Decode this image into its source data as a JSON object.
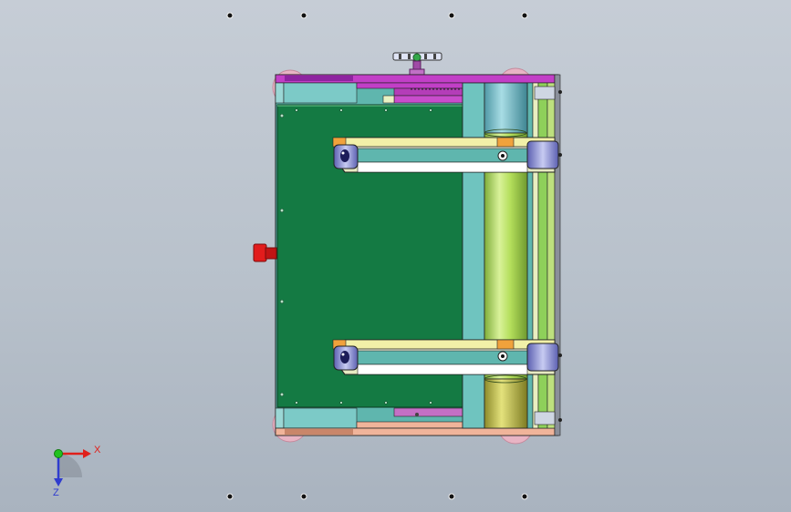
{
  "viewport": {
    "background_top": "#c6cdd6",
    "background_bottom": "#a9b3bf"
  },
  "triad": {
    "x_label": "X",
    "z_label": "Z",
    "x_color": "#e0201b",
    "z_color": "#2f3ccf",
    "y_color": "#21c21f"
  },
  "model": {
    "panel_color": "#147a43",
    "roller_color": "#b8e05a",
    "frame_color": "#6fc4bf",
    "top_bar_color": "#c23fc7",
    "bottom_bar_color": "#f0b49a",
    "motor_color": "#e21c1c"
  }
}
